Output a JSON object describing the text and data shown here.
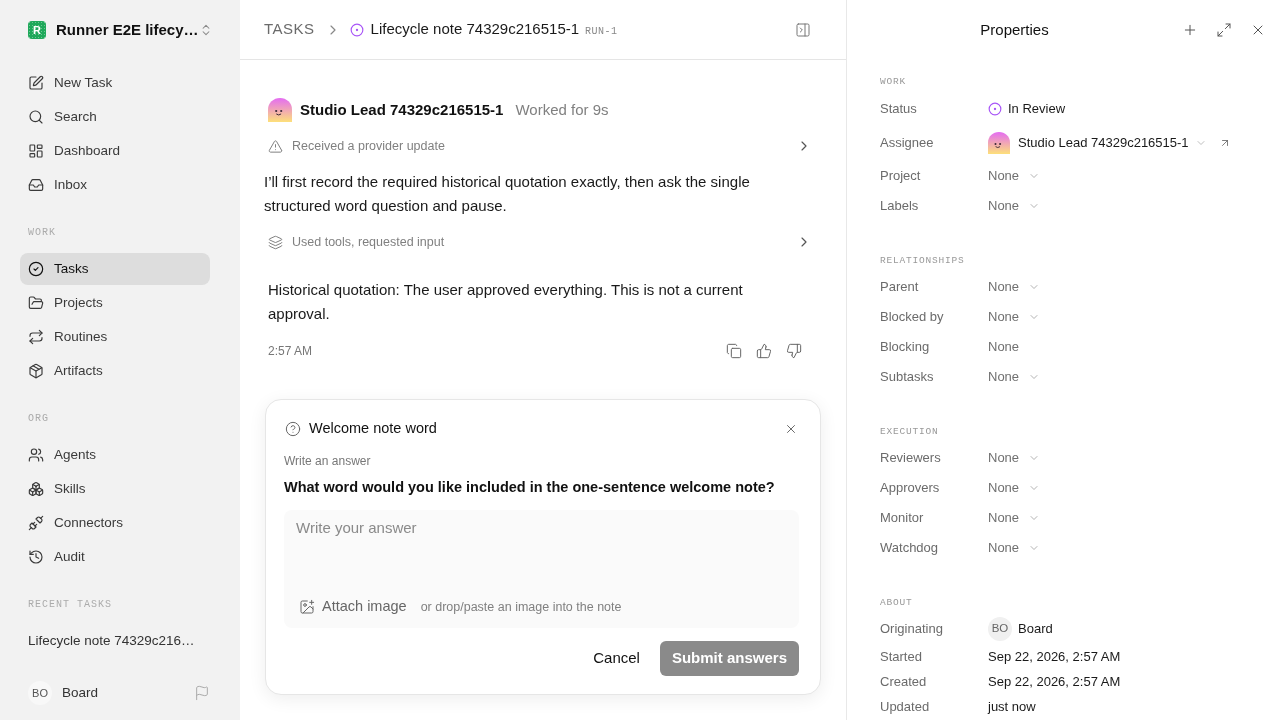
{
  "sidebar": {
    "workspace": {
      "logo_letter": "R",
      "name": "Runner E2E lifecy…"
    },
    "sections": [
      {
        "items": [
          {
            "label": "New Task",
            "selected": false
          },
          {
            "label": "Search",
            "selected": false
          },
          {
            "label": "Dashboard",
            "selected": false
          },
          {
            "label": "Inbox",
            "selected": false
          }
        ]
      },
      {
        "label": "WORK",
        "items": [
          {
            "label": "Tasks",
            "selected": true
          },
          {
            "label": "Projects",
            "selected": false
          },
          {
            "label": "Routines",
            "selected": false
          },
          {
            "label": "Artifacts",
            "selected": false
          }
        ]
      },
      {
        "label": "ORG",
        "items": [
          {
            "label": "Agents",
            "selected": false
          },
          {
            "label": "Skills",
            "selected": false
          },
          {
            "label": "Connectors",
            "selected": false
          },
          {
            "label": "Audit",
            "selected": false
          }
        ]
      }
    ],
    "recent": {
      "label": "RECENT TASKS",
      "items": [
        {
          "label": "Lifecycle note 74329c216…",
          "selected": false
        }
      ]
    },
    "user": {
      "initials": "BO",
      "name": "Board"
    }
  },
  "header": {
    "breadcrumb": "TASKS",
    "title": "Lifecycle note 74329c216515-1",
    "run": "RUN-1"
  },
  "message": {
    "author": "Studio Lead 74329c216515-1",
    "duration": "Worked for 9s",
    "steps": [
      {
        "kind": "alert",
        "text": "Received a provider update"
      },
      {
        "kind": "text",
        "text": "I’ll first record the required historical quotation exactly, then ask the single structured word question and pause."
      },
      {
        "kind": "tools",
        "text": "Used tools, requested input"
      }
    ],
    "reply": {
      "text": "Historical quotation: The user approved everything. This is not a current approval.",
      "time": "2:57 AM"
    }
  },
  "question": {
    "title": "Welcome note word",
    "hint": "Write an answer",
    "prompt": "What word would you like included in the one-sentence welcome note?",
    "placeholder": "Write your answer",
    "attach": "Attach image",
    "attach_hint": "or drop/paste an image into the note",
    "cancel": "Cancel",
    "submit": {
      "label": "Submit answers",
      "disabled": true
    }
  },
  "properties": {
    "title": "Properties",
    "sections": [
      {
        "label": "WORK",
        "rows": [
          {
            "kind": "status",
            "label": "Status",
            "value": "In Review"
          },
          {
            "kind": "agent",
            "label": "Assignee",
            "value": "Studio Lead 74329c216515-1"
          },
          {
            "kind": "select",
            "label": "Project",
            "value": "None"
          },
          {
            "kind": "select",
            "label": "Labels",
            "value": "None"
          }
        ]
      },
      {
        "label": "RELATIONSHIPS",
        "rows": [
          {
            "kind": "select",
            "label": "Parent",
            "value": "None"
          },
          {
            "kind": "select",
            "label": "Blocked by",
            "value": "None"
          },
          {
            "kind": "plain",
            "label": "Blocking",
            "value": "None"
          },
          {
            "kind": "select",
            "label": "Subtasks",
            "value": "None"
          }
        ]
      },
      {
        "label": "EXECUTION",
        "rows": [
          {
            "kind": "select",
            "label": "Reviewers",
            "value": "None"
          },
          {
            "kind": "select",
            "label": "Approvers",
            "value": "None"
          },
          {
            "kind": "select",
            "label": "Monitor",
            "value": "None"
          },
          {
            "kind": "select",
            "label": "Watchdog",
            "value": "None"
          }
        ]
      },
      {
        "label": "ABOUT",
        "rows": [
          {
            "kind": "user",
            "label": "Originating",
            "initials": "BO",
            "value": "Board"
          },
          {
            "kind": "date",
            "label": "Started",
            "value": "Sep 22, 2026, 2:57 AM"
          },
          {
            "kind": "date",
            "label": "Created",
            "value": "Sep 22, 2026, 2:57 AM"
          },
          {
            "kind": "date",
            "label": "Updated",
            "value": "just now"
          }
        ]
      }
    ]
  }
}
